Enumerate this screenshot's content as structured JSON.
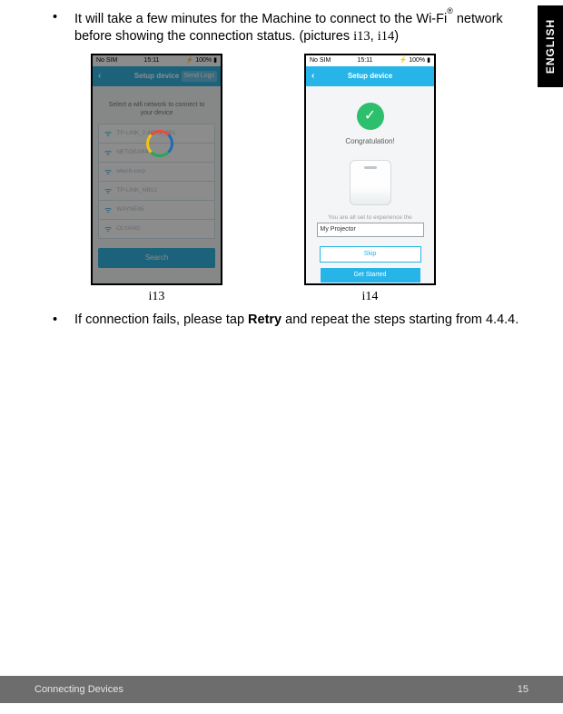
{
  "lang_tab": "ENGLISH",
  "bullets": {
    "p1_a": "It will take a few minutes for the Machine to connect to the Wi-Fi",
    "p1_reg": "®",
    "p1_b": " network before showing the connection status. (pictures ",
    "p1_ref1": "i13",
    "p1_c": ", ",
    "p1_ref2": "i14",
    "p1_d": ")",
    "p2_a": "If connection fails, please tap ",
    "p2_bold": "Retry",
    "p2_b": " and repeat the steps starting from 4.4.4."
  },
  "captions": {
    "left": "i13",
    "right": "i14"
  },
  "status": {
    "carrier": "No SIM",
    "time": "15:11",
    "battery": "100%"
  },
  "screen1": {
    "title": "Setup device",
    "send": "Send Logs",
    "instr": "Select a wifi network to connect to your device",
    "networks": [
      "TP-LINK_2.4GHz_5EL",
      "NETGEAR4",
      "wtech-corp",
      "TP-LINK_NB12",
      "WAYNE45",
      "OLYANG"
    ],
    "search": "Search"
  },
  "screen2": {
    "title": "Setup device",
    "congrats": "Congratulation!",
    "exp": "You are all set to experience the",
    "name": "My Projector",
    "skip": "Skip",
    "get": "Get Started"
  },
  "footer": {
    "section": "Connecting Devices",
    "page": "15"
  }
}
